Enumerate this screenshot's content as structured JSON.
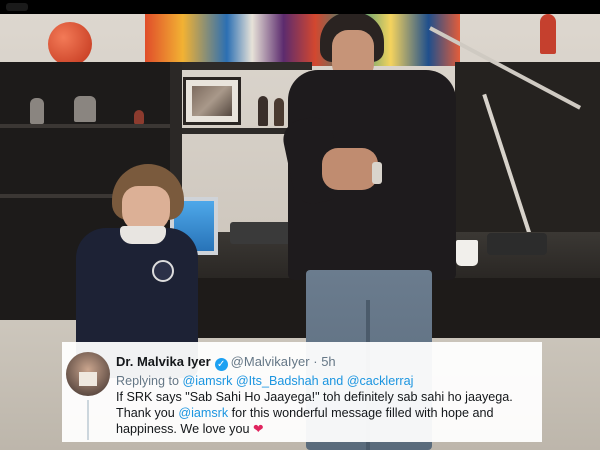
{
  "tweet": {
    "display_name": "Dr. Malvika Iyer",
    "verified_icon": "verified-badge-icon",
    "handle": "@MalvikaIyer",
    "separator": "·",
    "time": "5h",
    "replying_prefix": "Replying to",
    "reply_mentions": [
      "@iamsrk",
      "@Its_Badshah",
      "and",
      "@cacklerraj"
    ],
    "body_part1": "If SRK says \"Sab Sahi Ho Jaayega!\" toh definitely sab sahi ho jaayega. Thank you ",
    "body_mention": "@iamsrk",
    "body_part2": " for this wonderful message filled with hope and happiness. We love you ",
    "heart": "❤"
  },
  "colors": {
    "link": "#1b95e0",
    "verified": "#1da1f2",
    "heart": "#e0245e",
    "muted": "#657786"
  }
}
